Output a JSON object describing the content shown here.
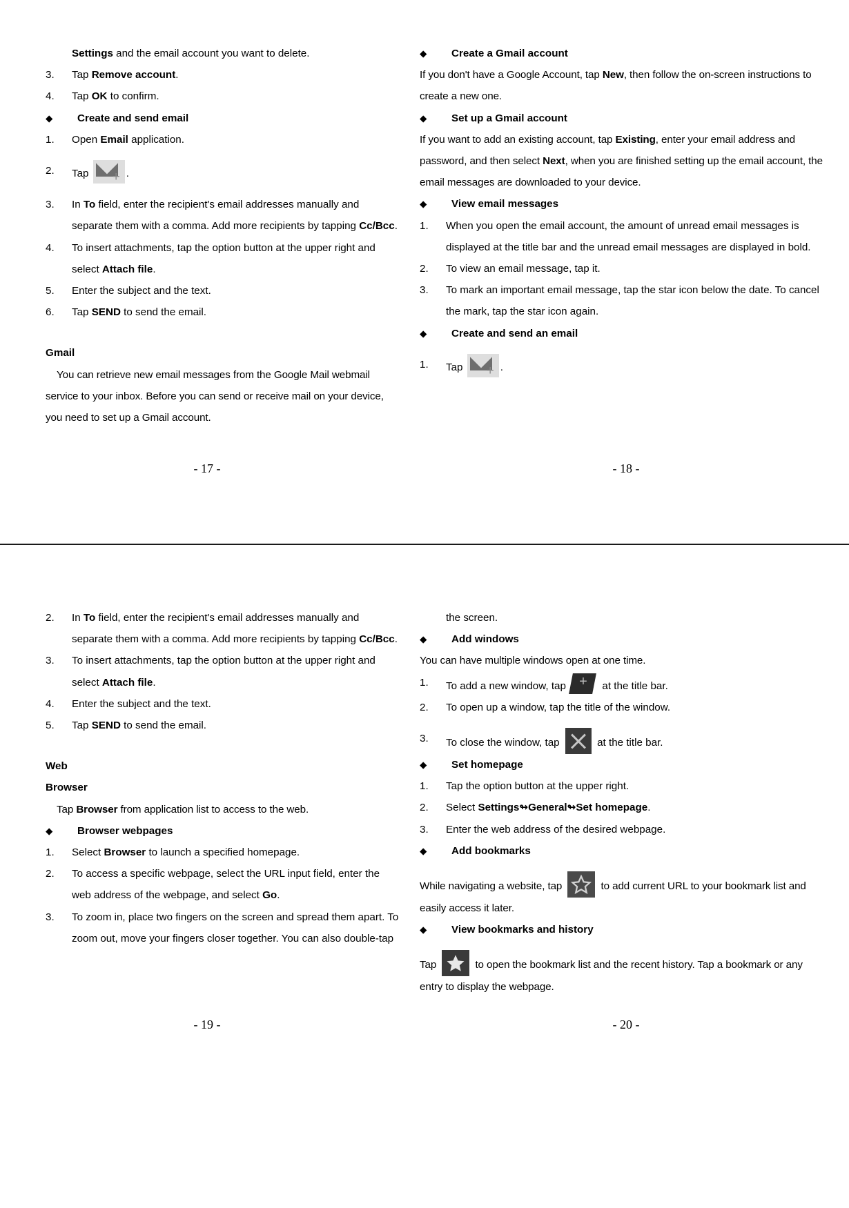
{
  "document": {
    "pages": [
      {
        "page_number": "- 17 -",
        "side": "left",
        "blocks": [
          {
            "type": "para",
            "indent_label": true,
            "text_html": "<b>Settings</b> and the email account you want to delete."
          },
          {
            "type": "num",
            "n": "3.",
            "text_html": "Tap <b>Remove account</b>."
          },
          {
            "type": "num",
            "n": "4.",
            "text_html": "Tap <b>OK</b> to confirm."
          },
          {
            "type": "bullet",
            "text": "Create and send email"
          },
          {
            "type": "num",
            "n": "1.",
            "text_html": "Open <b>Email</b> application."
          },
          {
            "type": "num",
            "n": "2.",
            "text_html": "Tap ICON_MAIL_PLUS ."
          },
          {
            "type": "num",
            "n": "3.",
            "text_html": "In <b>To</b> field, enter the recipient's email addresses manually and separate them with a comma. Add more recipients by tapping <b>Cc/Bcc</b>."
          },
          {
            "type": "num",
            "n": "4.",
            "text_html": "To insert attachments, tap the option button at the upper right and select <b>Attach file</b>."
          },
          {
            "type": "num",
            "n": "5.",
            "text_html": "Enter the subject and the text."
          },
          {
            "type": "num",
            "n": "6.",
            "text_html": "Tap <b>SEND</b> to send the email."
          },
          {
            "type": "heading",
            "text": "Gmail"
          },
          {
            "type": "para",
            "text": "You can retrieve new email messages from the Google Mail webmail service to your inbox. Before you can send or receive mail on your device, you need to set up a Gmail account."
          }
        ]
      },
      {
        "page_number": "- 18 -",
        "side": "right",
        "blocks": [
          {
            "type": "bullet",
            "text": "Create a Gmail account"
          },
          {
            "type": "para",
            "text_html": "If you don't have a Google Account, tap <b>New</b>, then follow the on-screen instructions to create a new one."
          },
          {
            "type": "bullet",
            "text": "Set up a Gmail account"
          },
          {
            "type": "para",
            "text_html": "If you want to add an existing account, tap <b>Existing</b>, enter your email address and password, and then select <b>Next</b>, when you are finished setting up the email account, the email messages are downloaded to your device."
          },
          {
            "type": "bullet",
            "text": "View email messages"
          },
          {
            "type": "num",
            "n": "1.",
            "text": "When you open the email account, the amount of unread email messages is displayed at the title bar and the unread email messages are displayed in bold."
          },
          {
            "type": "num",
            "n": "2.",
            "text": "To view an email message, tap it."
          },
          {
            "type": "num",
            "n": "3.",
            "text": "To mark an important email message, tap the star icon below the date. To cancel the mark, tap the star icon again."
          },
          {
            "type": "bullet",
            "text": "Create and send an email"
          },
          {
            "type": "num",
            "n": "1.",
            "text_html": "Tap ICON_MAIL_PLUS ."
          }
        ]
      },
      {
        "page_number": "- 19 -",
        "side": "left",
        "blocks": [
          {
            "type": "num",
            "n": "2.",
            "text_html": "In <b>To</b> field, enter the recipient's email addresses manually and separate them with a comma. Add more recipients by tapping <b>Cc/Bcc</b>."
          },
          {
            "type": "num",
            "n": "3.",
            "text_html": "To insert attachments, tap the option button at the upper right and select <b>Attach file</b>."
          },
          {
            "type": "num",
            "n": "4.",
            "text": "Enter the subject and the text."
          },
          {
            "type": "num",
            "n": "5.",
            "text_html": "Tap <b>SEND</b> to send the email."
          },
          {
            "type": "heading",
            "text": "Web"
          },
          {
            "type": "heading",
            "text": "Browser"
          },
          {
            "type": "para",
            "text_html": "Tap <b>Browser</b> from application list to access to the web."
          },
          {
            "type": "bullet",
            "text": "Browser webpages"
          },
          {
            "type": "num",
            "n": "1.",
            "text_html": "Select <b>Browser</b> to launch a specified homepage."
          },
          {
            "type": "num",
            "n": "2.",
            "text_html": "To access a specific webpage, select the URL input field, enter the web address of the webpage, and select <b>Go</b>."
          },
          {
            "type": "num",
            "n": "3.",
            "text": "To zoom in, place two fingers on the screen and spread them apart. To zoom out, move your fingers closer together. You can also double-tap"
          }
        ]
      },
      {
        "page_number": "- 20 -",
        "side": "right",
        "blocks": [
          {
            "type": "cont",
            "text": "the screen."
          },
          {
            "type": "bullet",
            "text": "Add windows"
          },
          {
            "type": "para",
            "text": "You can have multiple windows open at one time."
          },
          {
            "type": "num",
            "n": "1.",
            "text_html": "To add a new window, tap ICON_NEW_WINDOW at the title bar."
          },
          {
            "type": "num",
            "n": "2.",
            "text": "To open up a window, tap the title of the window."
          },
          {
            "type": "num",
            "n": "3.",
            "text_html": "To close the window, tap ICON_CLOSE at the title bar."
          },
          {
            "type": "bullet",
            "text": "Set homepage"
          },
          {
            "type": "num",
            "n": "1.",
            "text": "Tap the option button at the upper right."
          },
          {
            "type": "num",
            "n": "2.",
            "text_html": "Select <b>Settings</b>↬<b>General</b>↬<b>Set homepage</b>."
          },
          {
            "type": "num",
            "n": "3.",
            "text": "Enter the web address of the desired webpage."
          },
          {
            "type": "bullet",
            "text": "Add bookmarks"
          },
          {
            "type": "para",
            "text_html": "While navigating a website, tap ICON_STAR_OUTLINE to add current URL to your bookmark list and easily access it later."
          },
          {
            "type": "bullet",
            "text": "View bookmarks and history"
          },
          {
            "type": "para",
            "text_html": "Tap ICON_STAR_FILLED to open the bookmark list and the recent history. Tap a bookmark or any entry to display the webpage."
          }
        ]
      }
    ]
  },
  "p17": {
    "l1": "and the email account you want to delete.",
    "l1_bold": "Settings",
    "n3": "3.",
    "n3_pre": "Tap ",
    "n3_bold": "Remove account",
    "n3_post": ".",
    "n4": "4.",
    "n4_pre": "Tap ",
    "n4_bold": "OK",
    "n4_post": " to confirm.",
    "bullet1": "Create and send email",
    "i1": "1.",
    "i1_pre": "Open ",
    "i1_bold": "Email",
    "i1_post": " application.",
    "i2": "2.",
    "i2_pre": "Tap",
    "i2_post": ".",
    "i3": "3.",
    "i3_a": "In ",
    "i3_bold1": "To",
    "i3_b": " field, enter the recipient's email addresses manually and separate them with a comma. Add more recipients by tapping ",
    "i3_bold2": "Cc/Bcc",
    "i3_c": ".",
    "i4": "4.",
    "i4_a": "To insert attachments, tap the option button at the upper right and select ",
    "i4_bold": "Attach file",
    "i4_b": ".",
    "i5": "5.",
    "i5_t": "Enter the subject and the text.",
    "i6": "6.",
    "i6_a": "Tap ",
    "i6_bold": "SEND",
    "i6_b": " to send the email.",
    "gmail_head": "Gmail",
    "gmail_body": "You can retrieve new email messages from the Google Mail webmail service to your inbox. Before you can send or receive mail on your device, you need to set up a Gmail account.",
    "page_number": "- 17 -"
  },
  "p18": {
    "bullet1": "Create a Gmail account",
    "p1_a": "If you don't have a Google Account, tap ",
    "p1_bold": "New",
    "p1_b": ", then follow the on-screen instructions to create a new one.",
    "bullet2": "Set up a Gmail account",
    "p2_a": "If you want to add an existing account, tap ",
    "p2_bold1": "Existing",
    "p2_b": ", enter your email address and password, and then select ",
    "p2_bold2": "Next",
    "p2_c": ", when you are finished setting up the email account, the email messages are downloaded to your device.",
    "bullet3": "View email messages",
    "i1": "1.",
    "i1_t": "When you open the email account, the amount of unread email messages is displayed at the title bar and the unread email messages are displayed in bold.",
    "i2": "2.",
    "i2_t": "To view an email message, tap it.",
    "i3": "3.",
    "i3_t": "To mark an important email message, tap the star icon below the date. To cancel the mark, tap the star icon again.",
    "bullet4": "Create and send an email",
    "i4": "1.",
    "i4_pre": "Tap",
    "i4_post": ".",
    "page_number": "- 18 -"
  },
  "p19": {
    "i2": "2.",
    "i2_a": "In ",
    "i2_bold1": "To",
    "i2_b": " field, enter the recipient's email addresses manually and separate them with a comma. Add more recipients by tapping ",
    "i2_bold2": "Cc/Bcc",
    "i2_c": ".",
    "i3": "3.",
    "i3_a": "To insert attachments, tap the option button at the upper right and select ",
    "i3_bold": "Attach file",
    "i3_b": ".",
    "i4": "4.",
    "i4_t": "Enter the subject and the text.",
    "i5": "5.",
    "i5_a": "Tap ",
    "i5_bold": "SEND",
    "i5_b": " to send the email.",
    "head_web": "Web",
    "head_browser": "Browser",
    "intro_a": "Tap ",
    "intro_bold": "Browser",
    "intro_b": " from application list to access to the web.",
    "bullet1": "Browser webpages",
    "b1": "1.",
    "b1_a": "Select ",
    "b1_bold": "Browser",
    "b1_b": " to launch a specified homepage.",
    "b2": "2.",
    "b2_a": "To access a specific webpage, select the URL input field, enter the web address of the webpage, and select ",
    "b2_bold": "Go",
    "b2_b": ".",
    "b3": "3.",
    "b3_t": "To zoom in, place two fingers on the screen and spread them apart. To zoom out, move your fingers closer together. You can also double-tap",
    "page_number": "- 19 -"
  },
  "p20": {
    "cont": "the screen.",
    "bullet1": "Add windows",
    "p1": "You can have multiple windows open at one time.",
    "i1": "1.",
    "i1_pre": "To add a new window, tap",
    "i1_post": "at the title bar.",
    "i2": "2.",
    "i2_t": "To open up a window, tap the title of the window.",
    "i3": "3.",
    "i3_pre": "To close the window, tap",
    "i3_post": "at the title bar.",
    "bullet2": "Set homepage",
    "s1": "1.",
    "s1_t": "Tap the option button at the upper right.",
    "s2": "2.",
    "s2_pre": "Select ",
    "s2_b1": "Settings",
    "s2_ar1": "↬",
    "s2_b2": "General",
    "s2_ar2": "↬",
    "s2_b3": "Set homepage",
    "s2_post": ".",
    "s3": "3.",
    "s3_t": "Enter the web address of the desired webpage.",
    "bullet3": "Add bookmarks",
    "bm_pre": "While navigating a website, tap",
    "bm_post": "to add current URL to your bookmark list and easily access it later.",
    "bullet4": "View bookmarks and history",
    "vb_pre": "Tap",
    "vb_post": "to open the bookmark list and the recent history. Tap a bookmark or any entry to display the webpage.",
    "page_number": "- 20 -"
  },
  "icons": {
    "mail_plus": "email-compose-icon",
    "new_window": "new-window-icon",
    "close": "close-window-icon",
    "star_outline": "bookmark-add-star-icon",
    "star_filled": "bookmark-list-star-icon",
    "bullet_diamond": "◆"
  },
  "colors": {
    "text": "#000000",
    "page_background": "#ffffff",
    "icon_light_background": "#dedede",
    "icon_envelope": "#6e6e6e",
    "icon_dark": "#333333",
    "rule": "#1a1a1a"
  }
}
